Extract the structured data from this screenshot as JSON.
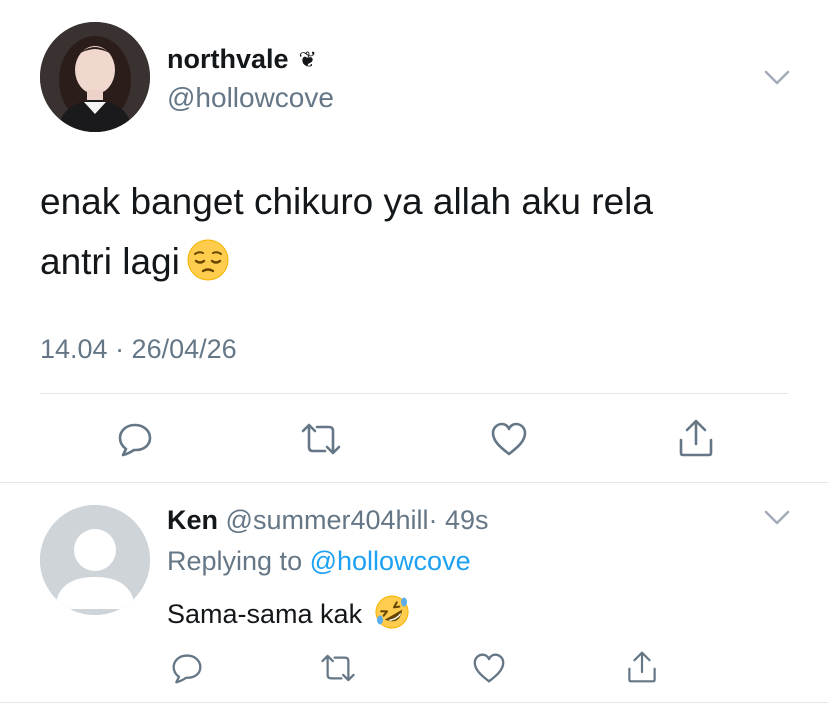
{
  "tweet": {
    "author": {
      "display_name": "northvale",
      "badge_emoji": "❦",
      "handle": "@hollowcove",
      "avatar_icon": "profile-photo"
    },
    "text_line1": "enak banget chikuro ya allah aku rela",
    "text_line2": "antri lagi",
    "emoji": "pensive-face",
    "timestamp": "14.04 · 26/04/26",
    "actions": [
      "reply-icon",
      "retweet-icon",
      "like-icon",
      "share-icon"
    ]
  },
  "reply": {
    "author": {
      "display_name": "Ken",
      "handle": "@summer404hill",
      "time": "· 49s",
      "avatar_icon": "default-avatar"
    },
    "replying_prefix": "Replying to",
    "replying_to": "@hollowcove",
    "text": "Sama-sama kak",
    "emoji": "rolling-on-floor-laughing",
    "actions": [
      "reply-icon",
      "retweet-icon",
      "like-icon",
      "share-icon"
    ]
  },
  "colors": {
    "primary_text": "#14171a",
    "secondary_text": "#657786",
    "link": "#1da1f2",
    "divider": "#e1e8ed",
    "icon": "#657786"
  }
}
